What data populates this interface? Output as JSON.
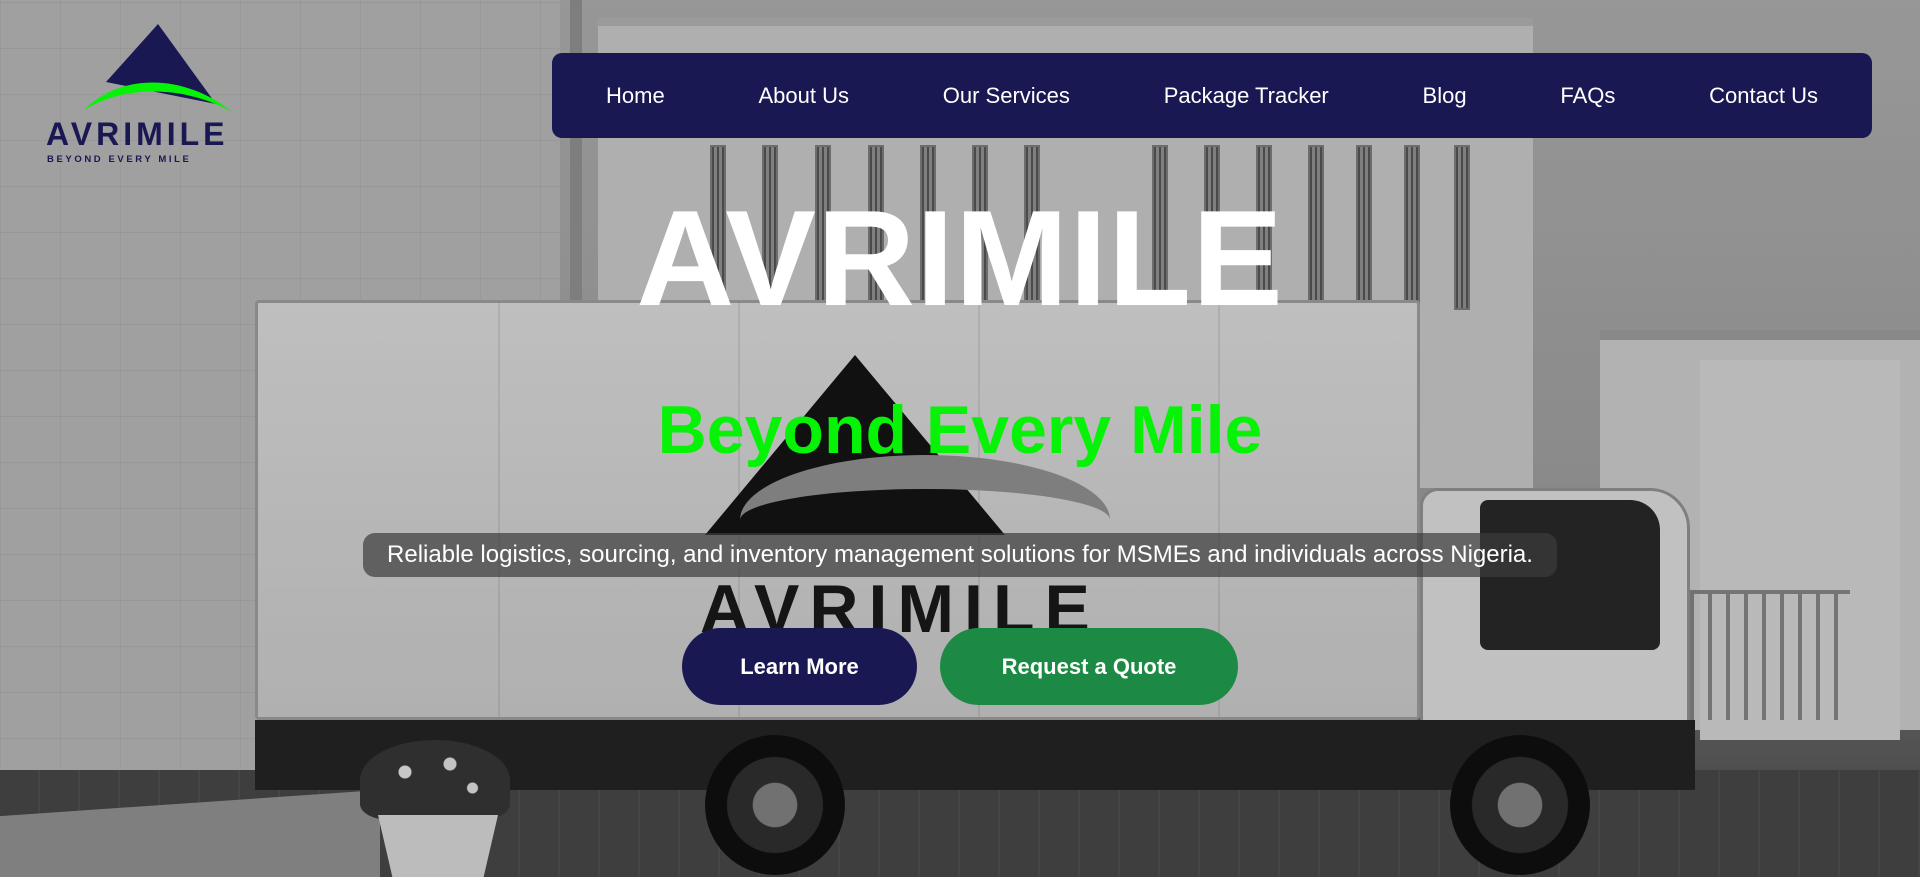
{
  "colors": {
    "brand_navy": "#1a1852",
    "brand_green": "#06f206",
    "quote_button_green": "#1c8a44",
    "text_white": "#ffffff"
  },
  "logo": {
    "name": "AVRIMILE",
    "tagline": "BEYOND EVERY MILE",
    "icon": "mountain-swoosh-logo-icon"
  },
  "nav": {
    "items": [
      {
        "label": "Home"
      },
      {
        "label": "About Us"
      },
      {
        "label": "Our Services"
      },
      {
        "label": "Package Tracker"
      },
      {
        "label": "Blog"
      },
      {
        "label": "FAQs"
      },
      {
        "label": "Contact Us"
      }
    ]
  },
  "hero": {
    "title": "AVRIMILE",
    "subtitle": "Beyond Every Mile",
    "description": "Reliable logistics, sourcing, and inventory management solutions for MSMEs and individuals across Nigeria.",
    "buttons": {
      "learn_more": "Learn More",
      "request_quote": "Request a Quote"
    }
  },
  "background": {
    "truck_logo_text": "AVRIMILE"
  }
}
